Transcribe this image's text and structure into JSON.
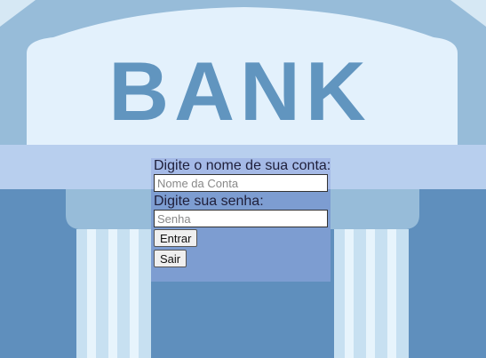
{
  "bank_sign": "BANK",
  "login": {
    "account_label": "Digite o nome de sua conta:",
    "account_placeholder": "Nome da Conta",
    "account_value": "",
    "password_label": "Digite sua senha:",
    "password_placeholder": "Senha",
    "password_value": "",
    "enter_button": "Entrar",
    "exit_button": "Sair"
  },
  "colors": {
    "sky": "#d6e8f4",
    "roof": "#97bcd9",
    "sign_bg": "#e3f1fc",
    "sign_text": "#6195bf",
    "band": "#b8cfee",
    "wall": "#5f8fbd",
    "column": "#c7e0f1",
    "login_panel": "#96aae1"
  }
}
